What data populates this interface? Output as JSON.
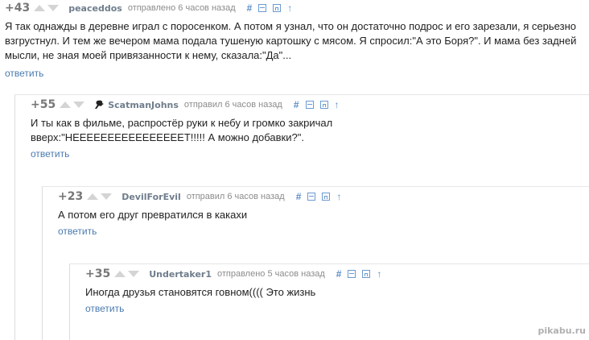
{
  "comments": [
    {
      "rating": "+43",
      "author": "peaceddos",
      "time": "отправлено 6 часов назад",
      "text": "Я так однажды в деревне играл с поросенком. А потом я узнал, что он достаточно подрос и его зарезали, я серьезно взгрустнул. И тем же вечером мама подала тушеную картошку с мясом. Я спросил:\"А это Боря?\". И мама без задней мысли, не зная моей привязанности к нему, сказала:\"Да\"...",
      "reply": "ответить"
    },
    {
      "rating": "+55",
      "author": "ScatmanJohns",
      "time": "отправил 6 часов назад",
      "text": "И ты как в фильме, распростёр руки к небу и громко закричал вверх:\"НЕЕЕЕЕЕЕЕЕЕЕЕЕЕЕЕТ!!!!! А можно добавки?\".",
      "reply": "ответить"
    },
    {
      "rating": "+23",
      "author": "DevilForEvil",
      "time": "отправил 6 часов назад",
      "text": "А потом его друг превратился в какахи",
      "reply": "ответить"
    },
    {
      "rating": "+35",
      "author": "Undertaker1",
      "time": "отправлено 5 часов назад",
      "text": "Иногда друзья становятся говном(((( Это жизнь",
      "reply": "ответить"
    }
  ],
  "tools": {
    "link": "#",
    "up": "↑"
  },
  "watermark": "pikabu.ru",
  "colors": {
    "accent": "#5b8ec7",
    "author": "#6f7d8c",
    "vote": "#d4d4d4"
  }
}
